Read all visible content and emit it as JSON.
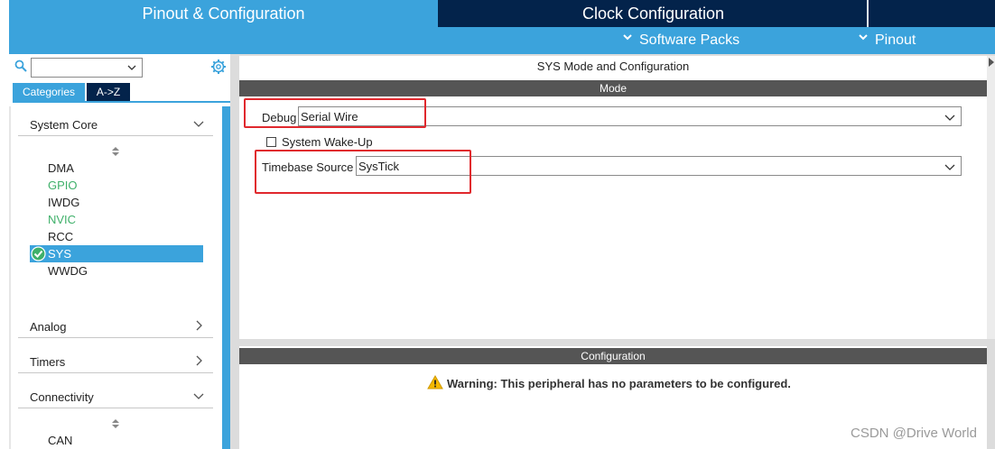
{
  "header": {
    "tab_pinout": "Pinout & Configuration",
    "tab_clock": "Clock Configuration",
    "software_packs": "Software Packs",
    "pinout_menu": "Pinout"
  },
  "sidebar": {
    "search": {
      "value": "",
      "placeholder": ""
    },
    "tabs": {
      "categories": "Categories",
      "az": "A->Z"
    },
    "groups": {
      "system_core": "System Core",
      "analog": "Analog",
      "timers": "Timers",
      "connectivity": "Connectivity"
    },
    "system_core_items": [
      "DMA",
      "GPIO",
      "IWDG",
      "NVIC",
      "RCC",
      "SYS",
      "WWDG"
    ],
    "connectivity_items": [
      "CAN"
    ],
    "selected_item": "SYS"
  },
  "mode": {
    "title": "SYS Mode and Configuration",
    "bar": "Mode",
    "debug_label": "Debug",
    "debug_value": "Serial Wire",
    "wakeup_label": "System Wake-Up",
    "wakeup_checked": false,
    "timebase_label": "Timebase Source",
    "timebase_value": "SysTick"
  },
  "configuration": {
    "bar": "Configuration",
    "warning": "Warning: This peripheral has no parameters to be configured."
  },
  "watermark": "CSDN @Drive World",
  "colors": {
    "accent": "#3ba3dc",
    "navy": "#03234b",
    "enabled_green": "#3fb06a",
    "highlight_red": "#e0282d"
  }
}
